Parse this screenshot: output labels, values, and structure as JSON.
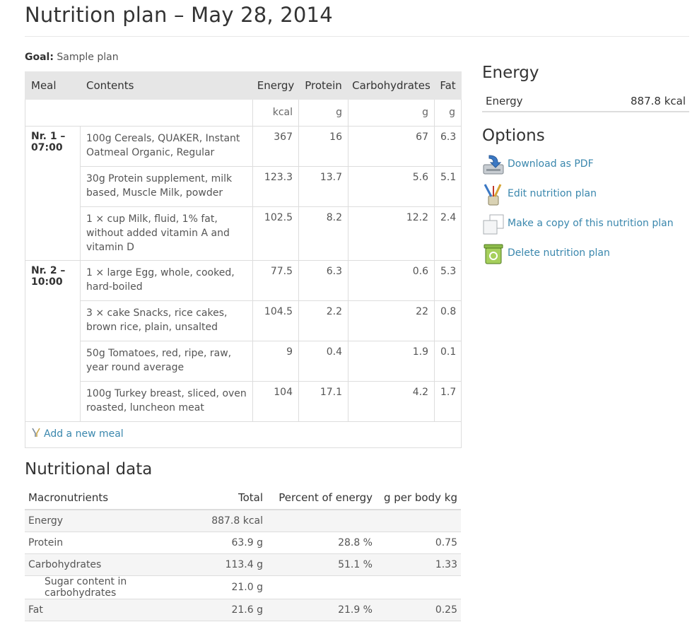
{
  "page_title": "Nutrition plan – May 28, 2014",
  "goal": {
    "label": "Goal:",
    "value": "Sample plan"
  },
  "meal_table": {
    "headers": {
      "meal": "Meal",
      "contents": "Contents",
      "energy": "Energy",
      "protein": "Protein",
      "carbohydrates": "Carbohydrates",
      "fat": "Fat"
    },
    "units": {
      "energy": "kcal",
      "protein": "g",
      "carbohydrates": "g",
      "fat": "g"
    },
    "meals": [
      {
        "name": "Nr. 1 – 07:00",
        "items": [
          {
            "contents": "100g Cereals, QUAKER, Instant Oatmeal Organic, Regular",
            "energy": "367",
            "protein": "16",
            "carbohydrates": "67",
            "fat": "6.3"
          },
          {
            "contents": "30g Protein supplement, milk based, Muscle Milk, powder",
            "energy": "123.3",
            "protein": "13.7",
            "carbohydrates": "5.6",
            "fat": "5.1"
          },
          {
            "contents": "1 × cup Milk, fluid, 1% fat, without added vitamin A and vitamin D",
            "energy": "102.5",
            "protein": "8.2",
            "carbohydrates": "12.2",
            "fat": "2.4"
          }
        ]
      },
      {
        "name": "Nr. 2 – 10:00",
        "items": [
          {
            "contents": "1 × large Egg, whole, cooked, hard-boiled",
            "energy": "77.5",
            "protein": "6.3",
            "carbohydrates": "0.6",
            "fat": "5.3"
          },
          {
            "contents": "3 × cake Snacks, rice cakes, brown rice, plain, unsalted",
            "energy": "104.5",
            "protein": "2.2",
            "carbohydrates": "22",
            "fat": "0.8"
          },
          {
            "contents": "50g Tomatoes, red, ripe, raw, year round average",
            "energy": "9",
            "protein": "0.4",
            "carbohydrates": "1.9",
            "fat": "0.1"
          },
          {
            "contents": "100g Turkey breast, sliced, oven roasted, luncheon meat",
            "energy": "104",
            "protein": "17.1",
            "carbohydrates": "4.2",
            "fat": "1.7"
          }
        ]
      }
    ],
    "add_meal_label": "Add a new meal",
    "add_meal_icon": "fork-knife-icon"
  },
  "nutritional_data": {
    "heading": "Nutritional data",
    "headers": {
      "macronutrients": "Macronutrients",
      "total": "Total",
      "percent": "Percent of energy",
      "per_kg": "g per body kg"
    },
    "rows": [
      {
        "name": "Energy",
        "total": "887.8 kcal",
        "percent": "",
        "per_kg": ""
      },
      {
        "name": "Protein",
        "total": "63.9 g",
        "percent": "28.8 %",
        "per_kg": "0.75"
      },
      {
        "name": "Carbohydrates",
        "total": "113.4 g",
        "percent": "51.1 %",
        "per_kg": "1.33"
      },
      {
        "name": "Sugar content in carbohydrates",
        "total": "21.0 g",
        "percent": "",
        "per_kg": ""
      },
      {
        "name": "Fat",
        "total": "21.6 g",
        "percent": "21.9 %",
        "per_kg": "0.25"
      }
    ]
  },
  "sidebar": {
    "energy_heading": "Energy",
    "energy_label": "Energy",
    "energy_value": "887.8 kcal",
    "options_heading": "Options",
    "options": [
      {
        "label": "Download as PDF",
        "icon": "download-pdf-icon"
      },
      {
        "label": "Edit nutrition plan",
        "icon": "edit-brush-icon"
      },
      {
        "label": "Make a copy of this nutrition plan",
        "icon": "copy-icon"
      },
      {
        "label": "Delete nutrition plan",
        "icon": "trash-can-icon"
      }
    ]
  },
  "colors": {
    "link": "#3a87ad",
    "header_bg": "#e6e6e6",
    "border": "#dddddd",
    "text": "#333333"
  }
}
